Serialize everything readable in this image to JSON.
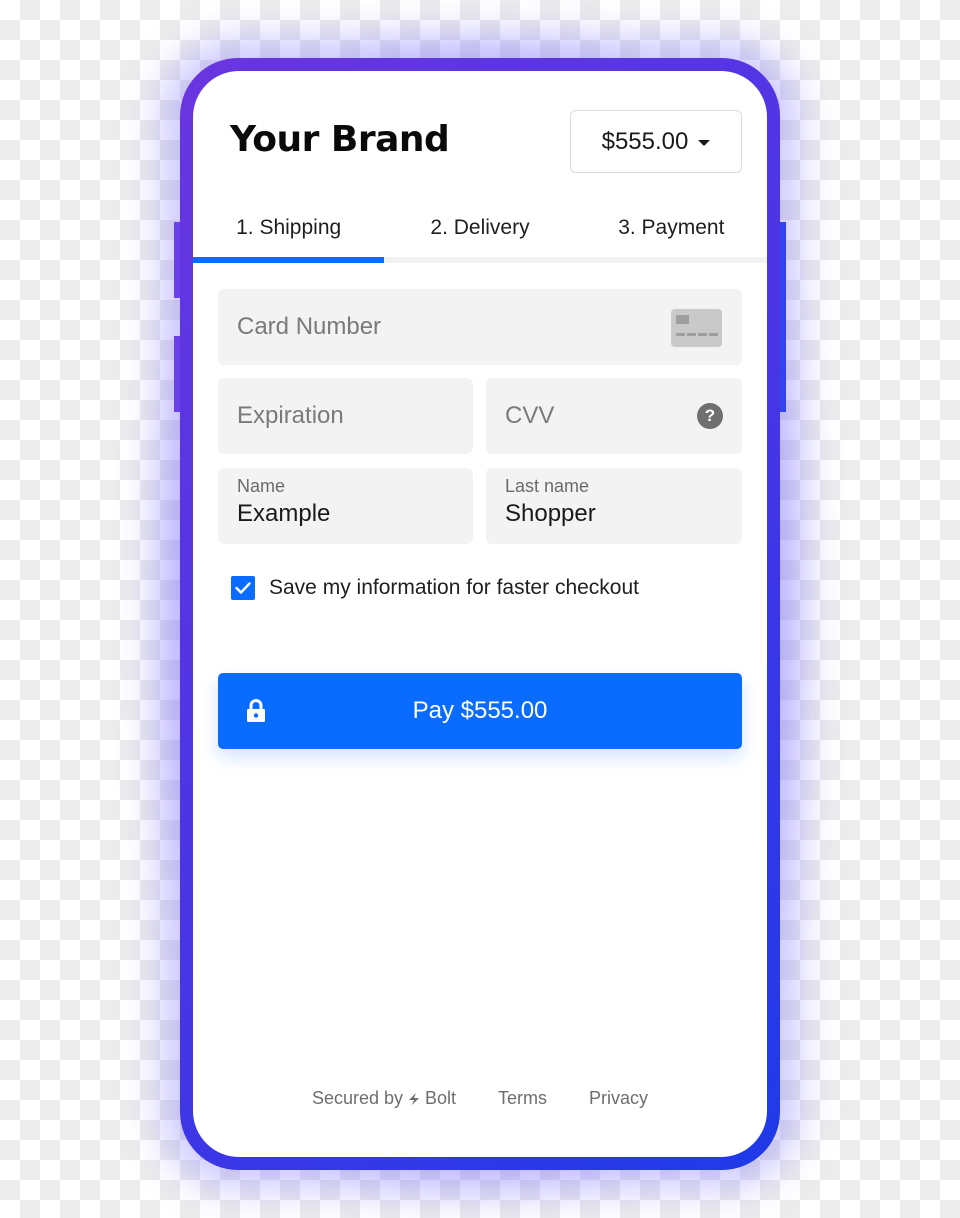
{
  "header": {
    "brand": "Your Brand",
    "amount": "$555.00"
  },
  "tabs": [
    {
      "label": "1. Shipping",
      "active": true
    },
    {
      "label": "2. Delivery",
      "active": false
    },
    {
      "label": "3. Payment",
      "active": false
    }
  ],
  "progress": {
    "completed_steps": 1,
    "total_steps": 3
  },
  "form": {
    "card_number": {
      "placeholder": "Card Number",
      "icon": "credit-card-icon"
    },
    "expiration": {
      "placeholder": "Expiration"
    },
    "cvv": {
      "placeholder": "CVV",
      "icon": "help-icon"
    },
    "name": {
      "label": "Name",
      "value": "Example"
    },
    "last_name": {
      "label": "Last name",
      "value": "Shopper"
    },
    "save_info": {
      "label": "Save my information for faster checkout",
      "checked": true
    }
  },
  "pay_button": {
    "label": "Pay $555.00",
    "icon": "lock-icon"
  },
  "footer": {
    "secured_prefix": "Secured by",
    "secured_brand": "Bolt",
    "terms": "Terms",
    "privacy": "Privacy"
  },
  "colors": {
    "accent": "#0a6cff",
    "frame_start": "#6a35e0",
    "frame_end": "#1e3ae8",
    "field_bg": "#f3f3f3"
  }
}
